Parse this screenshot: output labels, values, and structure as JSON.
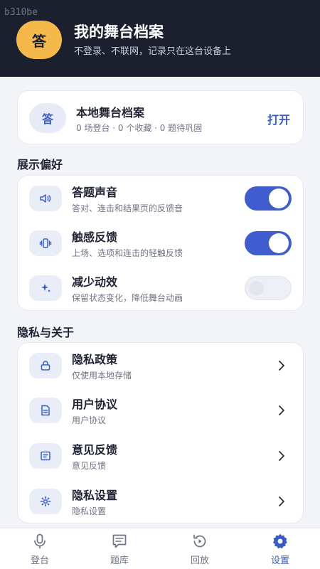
{
  "watermark": "b310be",
  "header": {
    "avatar_text": "答",
    "title": "我的舞台档案",
    "subtitle": "不登录、不联网，记录只在这台设备上"
  },
  "archive": {
    "icon_text": "答",
    "title": "本地舞台档案",
    "subtitle": "0 场登台 · 0 个收藏 · 0 题待巩固",
    "action": "打开"
  },
  "display_prefs": {
    "section_title": "展示偏好",
    "items": [
      {
        "icon": "sound-icon",
        "title": "答题声音",
        "subtitle": "答对、连击和结果页的反馈音",
        "enabled": true
      },
      {
        "icon": "vibration-icon",
        "title": "触感反馈",
        "subtitle": "上场、选项和连击的轻触反馈",
        "enabled": true
      },
      {
        "icon": "sparkle-icon",
        "title": "减少动效",
        "subtitle": "保留状态变化，降低舞台动画",
        "enabled": false
      }
    ]
  },
  "privacy": {
    "section_title": "隐私与关于",
    "items": [
      {
        "icon": "lock-icon",
        "title": "隐私政策",
        "subtitle": "仅使用本地存储"
      },
      {
        "icon": "document-icon",
        "title": "用户协议",
        "subtitle": "用户协议"
      },
      {
        "icon": "feedback-icon",
        "title": "意见反馈",
        "subtitle": "意见反馈"
      },
      {
        "icon": "gear-icon",
        "title": "隐私设置",
        "subtitle": "隐私设置"
      }
    ]
  },
  "tabbar": {
    "tabs": [
      {
        "icon": "microphone-icon",
        "label": "登台",
        "active": false
      },
      {
        "icon": "question-bank-icon",
        "label": "题库",
        "active": false
      },
      {
        "icon": "replay-icon",
        "label": "回放",
        "active": false
      },
      {
        "icon": "settings-gear-icon",
        "label": "设置",
        "active": true
      }
    ]
  },
  "colors": {
    "header_bg": "#1b1f2e",
    "accent": "#3f5dcc",
    "avatar": "#f5b84a",
    "page_bg": "#f3f4f8"
  }
}
